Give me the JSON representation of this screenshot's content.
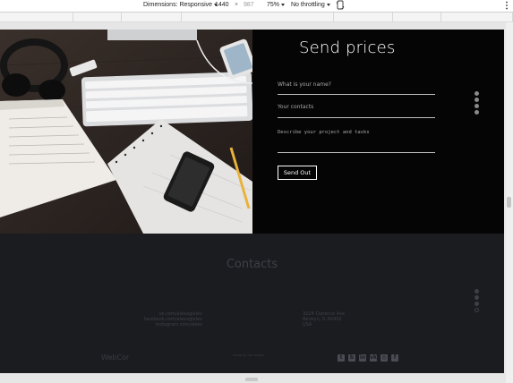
{
  "toolbar": {
    "dimensions_label": "Dimensions: Responsive",
    "width_value": "1440",
    "times_sign": "×",
    "height_placeholder": "987",
    "zoom_label": "75%",
    "throttle_label": "No throttling",
    "rotate_icon": "rotate-icon",
    "more_icon": "more-vertical-icon"
  },
  "form": {
    "title": "Send prices",
    "name_placeholder": "What is your name?",
    "contacts_placeholder": "Your contacts",
    "project_placeholder": "Describe your project and tasks",
    "submit_label": "Send Out"
  },
  "contacts": {
    "title": "Contacts",
    "links": [
      "vk.com/alexaglalev",
      "facebook.com/alexaglalev",
      "instagram.com/alexs"
    ],
    "address": [
      "3224 Clarence Ave",
      "Berwyn, IL 60402",
      "USA"
    ]
  },
  "footer": {
    "logo": "WebCor",
    "credit": "made by the rouges",
    "socials": [
      "twitter-icon",
      "blogger-icon",
      "linkedin-icon",
      "vk-icon",
      "instagram-icon",
      "facebook-icon"
    ]
  },
  "colors": {
    "page_bg": "#1b1c20",
    "form_bg": "#050505",
    "text_muted": "#3e4047"
  }
}
